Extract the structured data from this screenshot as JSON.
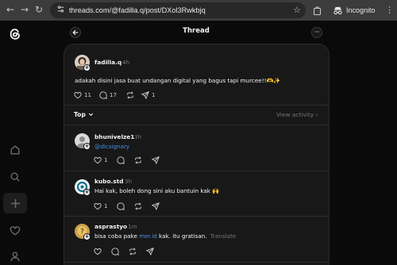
{
  "browser": {
    "url": "threads.com/@fadilla.q/post/DXol3Rwkbjq",
    "incognito_label": "Incognito"
  },
  "header": {
    "title": "Thread"
  },
  "post": {
    "username": "fadilla.q",
    "time": "4h",
    "text": "adakah disini jasa buat undangan digital yang bagus tapi murcee!!🫶✨",
    "likes": "11",
    "replies": "17",
    "shares": "1"
  },
  "sort": {
    "label": "Top",
    "view_activity": "View activity"
  },
  "replies": [
    {
      "username": "bhunivelze1",
      "time": "3h",
      "text_link": "@dicsignary",
      "likes": "1"
    },
    {
      "username": "kubo.std",
      "time": "3h",
      "text": "Hai kak, boleh dong sini aku bantuin kak 🙌",
      "likes": "1"
    },
    {
      "username": "asprastyo",
      "time": "1m",
      "text_before": "bisa coba pake ",
      "text_link": "mer.id",
      "text_after": " kak. itu gratisan.",
      "translate": "Translate"
    }
  ],
  "colors": {
    "background": "#0a0a0a",
    "panel": "#181818",
    "text": "#f3f5f7",
    "muted": "#777777",
    "link": "#4a90e2"
  }
}
